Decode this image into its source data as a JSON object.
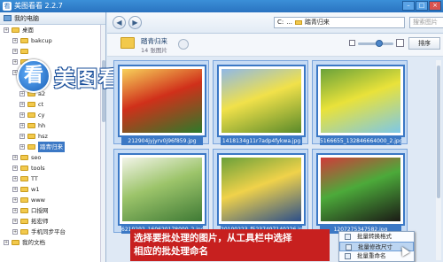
{
  "window": {
    "title": "美图看看 2.2.7",
    "app_icon": "看"
  },
  "left_panel": {
    "header": "我的电脑",
    "tree": [
      {
        "label": "桌面",
        "icon": "folder"
      },
      {
        "label": "bakcup",
        "icon": "folder"
      },
      {
        "label": "",
        "icon": "folder"
      },
      {
        "label": "",
        "icon": "folder"
      },
      {
        "label": "",
        "icon": "folder"
      },
      {
        "label": "007",
        "icon": "folder"
      },
      {
        "label": "a2",
        "icon": "folder"
      },
      {
        "label": "ct",
        "icon": "folder"
      },
      {
        "label": "cy",
        "icon": "folder"
      },
      {
        "label": "hh",
        "icon": "folder"
      },
      {
        "label": "hsz",
        "icon": "folder"
      },
      {
        "label": "踏青归来",
        "icon": "folder",
        "selected": true
      },
      {
        "label": "seo",
        "icon": "folder"
      },
      {
        "label": "tools",
        "icon": "folder"
      },
      {
        "label": "TT",
        "icon": "folder"
      },
      {
        "label": "w1",
        "icon": "folder"
      },
      {
        "label": "www",
        "icon": "folder"
      },
      {
        "label": "口授网",
        "icon": "folder"
      },
      {
        "label": "拓宏师",
        "icon": "folder"
      },
      {
        "label": "手机同步平台",
        "icon": "folder"
      },
      {
        "label": "我的文档",
        "icon": "folder"
      }
    ]
  },
  "logo": {
    "text": "美图看看",
    "icon": "看"
  },
  "toolbar": {
    "back": "◀",
    "forward": "▶",
    "address": [
      "C:",
      "...",
      "踏青归来"
    ],
    "search_placeholder": "搜索图片"
  },
  "info": {
    "folder_name": "踏青归来",
    "count": "14 张图片",
    "sort_label": "排序"
  },
  "thumbnails": [
    {
      "filename": "212904jyjyrv0j96f859.jpg",
      "colors": [
        "#2d7a2a",
        "#d0301a",
        "#f7d15a"
      ]
    },
    {
      "filename": "1418134g11r7adp4fykwa.jpg",
      "colors": [
        "#5a8a2a",
        "#f1e14a",
        "#8fb8e8"
      ]
    },
    {
      "filename": "5166655_132846664000_2.jpg",
      "colors": [
        "#7dc8e8",
        "#e9e23a",
        "#6aa23a"
      ]
    },
    {
      "filename": "6210292_160620178000_2.jpg",
      "colors": [
        "#3f7a35",
        "#9cc46a",
        "#f2f4e8"
      ]
    },
    {
      "filename": "20100223_f5237497140226.jpg",
      "colors": [
        "#2c4f8a",
        "#f0d24a",
        "#6aa03a"
      ]
    },
    {
      "filename": "1207275347582.jpg",
      "colors": [
        "#1b1b16",
        "#4caa3a",
        "#d23a3a"
      ]
    }
  ],
  "banner": {
    "line1": "选择要批处理的图片，从工具栏中选择",
    "line2": "相应的批处理命名"
  },
  "context_menu": {
    "items": [
      "批量转换格式",
      "批量修改尺寸",
      "批量重命名"
    ]
  }
}
